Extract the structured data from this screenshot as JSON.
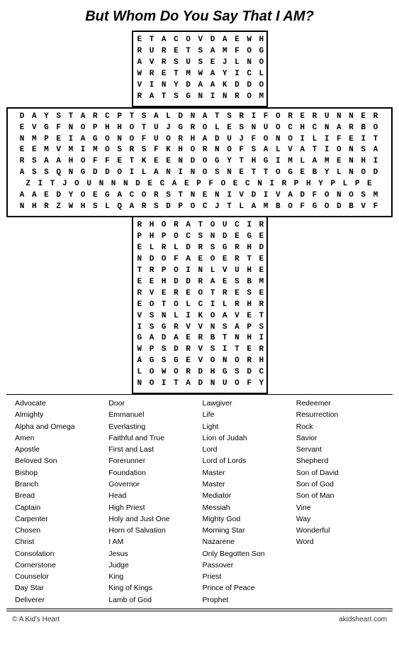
{
  "page": {
    "title": "But Whom Do You Say That I AM?"
  },
  "cross_top_rows": [
    "E T A C O V D A E W H",
    "R U R E T S A M F O G",
    "A V R S U S E J L N O",
    "W R E T M W A Y I C L",
    "V I N Y D A A K D D O",
    "R A T S G N I N R O M"
  ],
  "cross_horiz_rows": [
    "D A Y S T A R C P T S A L D N A T S R I F O R E R U N N E R",
    "E V G F N O P H H O T U J G R O L E S N U O C H C N A R B O",
    "N M P E I A G O N O F U O R H A D U J F O N O I L I F E I T",
    "E E M V M I M O S R S F K H O R N O F S A L V A T I O N S A",
    "R S A A H O F F E T K E E N D O G Y T H G I M L A M E N H I",
    "A S S Q N G D D O I L A N I N O S N E T T O G E B Y L N O D",
    "Z I T J O U N N N D E C A E P F O E C N I R P H Y P L P E",
    "A A E D Y O E G A C O R S T N E N I V D I V A D F O N O S M",
    "N H R Z W H S L Q A R S D P O C J T L A M B O F G O D B V F"
  ],
  "cross_bottom_rows": [
    "R H O R A T O U C I R",
    "P H P O C S N D E G E",
    "E L R L D R S G R H D",
    "N D O F A E O E R T E",
    "T R P O I N L V U H E",
    "E E H D D R A E S B M",
    "R V E R E O T R E S E",
    "E O T O L C I L R H R",
    "V S N L I K O A V E T",
    "I S G R V V N S A P S",
    "G A D A E R B T N H I",
    "W P S D R V S I T E R",
    "A G S G E V O N O R H",
    "L O W O R D H G S D C",
    "N O I T A D N U O F Y"
  ],
  "word_list": {
    "col1": [
      "Advocate",
      "Almighty",
      "Alpha and Omega",
      "Amen",
      "Apostle",
      "Beloved Son",
      "Bishop",
      "Branch",
      "Bread",
      "Captain",
      "Carpenter",
      "Chosen",
      "Christ",
      "Consolation",
      "Cornerstone",
      "Counselor",
      "Day Star",
      "Deliverer"
    ],
    "col2": [
      "Door",
      "Emmanuel",
      "Everlasting",
      "Faithful and True",
      "First and Last",
      "Forerunner",
      "Foundation",
      "Governor",
      "Head",
      "High Priest",
      "Holy and Just One",
      "Horn of Salvation",
      "I AM",
      "Jesus",
      "Judge",
      "King",
      "King of Kings",
      "Lamb of God"
    ],
    "col3": [
      "Lawgiver",
      "Life",
      "Light",
      "Lion of Judah",
      "Lord",
      "Lord of Lords",
      "Master",
      "Master",
      "Mediator",
      "Messiah",
      "Mighty God",
      "Morning Star",
      "Nazarene",
      "Only Begotten Son",
      "Passover",
      "Priest",
      "Prince of Peace",
      "Prophet"
    ],
    "col4": [
      "Redeemer",
      "Resurrection",
      "Rock",
      "Savior",
      "Servant",
      "Shepherd",
      "Son of David",
      "Son of God",
      "Son of Man",
      "Vine",
      "Way",
      "Wonderful",
      "Word"
    ]
  },
  "footer": {
    "left": "© A Kid's Heart",
    "right": "akidsheart.com"
  }
}
